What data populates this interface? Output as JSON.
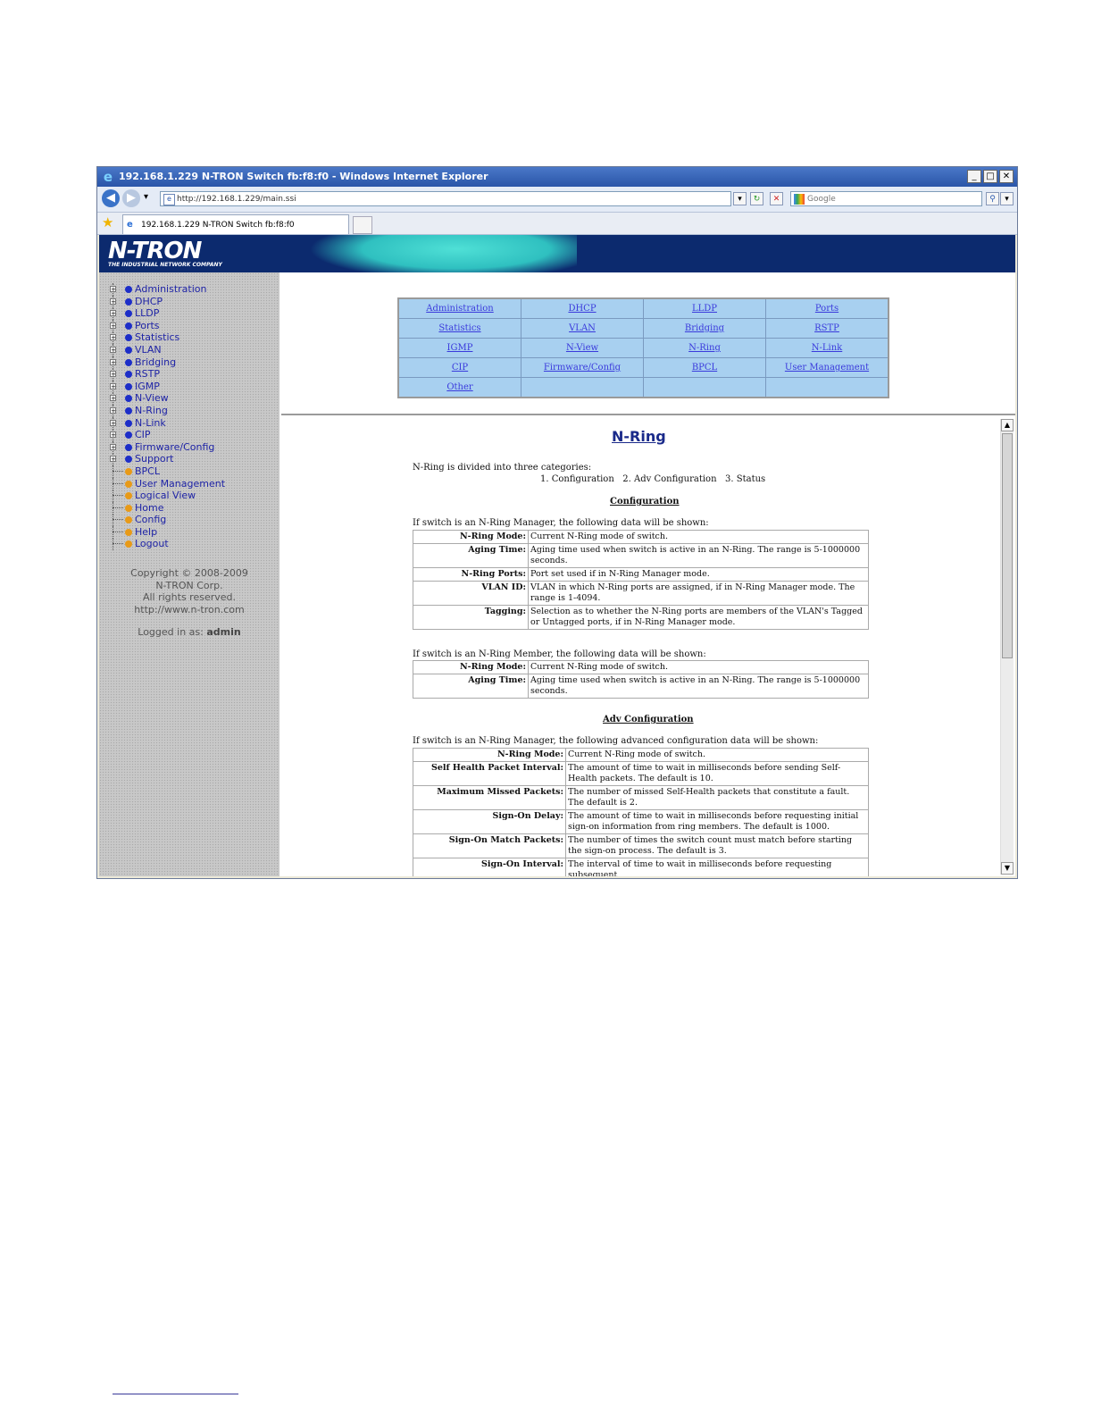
{
  "window": {
    "title": "192.168.1.229 N-TRON Switch fb:f8:f0 - Windows Internet Explorer",
    "minimize": "_",
    "maximize": "□",
    "close": "✕"
  },
  "navbar": {
    "back": "◀",
    "forward": "▶",
    "dropdown": "▾",
    "address": "http://192.168.1.229/main.ssi",
    "search_placeholder": "Google",
    "search_icon": "search-icon"
  },
  "tab": {
    "label": "192.168.1.229 N-TRON Switch fb:f8:f0"
  },
  "banner": {
    "logo": "N-TRON",
    "tagline": "THE INDUSTRIAL NETWORK COMPANY"
  },
  "sidebar": {
    "items": [
      {
        "label": "Administration",
        "type": "folder"
      },
      {
        "label": "DHCP",
        "type": "folder"
      },
      {
        "label": "LLDP",
        "type": "folder"
      },
      {
        "label": "Ports",
        "type": "folder"
      },
      {
        "label": "Statistics",
        "type": "folder"
      },
      {
        "label": "VLAN",
        "type": "folder"
      },
      {
        "label": "Bridging",
        "type": "folder"
      },
      {
        "label": "RSTP",
        "type": "folder"
      },
      {
        "label": "IGMP",
        "type": "folder"
      },
      {
        "label": "N-View",
        "type": "folder"
      },
      {
        "label": "N-Ring",
        "type": "folder"
      },
      {
        "label": "N-Link",
        "type": "folder"
      },
      {
        "label": "CIP",
        "type": "folder"
      },
      {
        "label": "Firmware/Config",
        "type": "folder"
      },
      {
        "label": "Support",
        "type": "folder"
      },
      {
        "label": "BPCL",
        "type": "page"
      },
      {
        "label": "User Management",
        "type": "page"
      },
      {
        "label": "Logical View",
        "type": "page"
      },
      {
        "label": "Home",
        "type": "page"
      },
      {
        "label": "Config",
        "type": "page"
      },
      {
        "label": "Help",
        "type": "page"
      },
      {
        "label": "Logout",
        "type": "page"
      }
    ],
    "copyright_lines": [
      "Copyright © 2008-2009",
      "N-TRON Corp.",
      "All rights reserved.",
      "http://www.n-tron.com"
    ],
    "logged_prefix": "Logged in as:",
    "logged_user": "admin"
  },
  "menu_grid": [
    [
      "Administration",
      "DHCP",
      "LLDP",
      "Ports"
    ],
    [
      "Statistics",
      "VLAN",
      "Bridging",
      "RSTP"
    ],
    [
      "IGMP",
      "N-View",
      "N-Ring",
      "N-Link"
    ],
    [
      "CIP",
      "Firmware/Config",
      "BPCL",
      "User Management"
    ],
    [
      "Other",
      "",
      "",
      ""
    ]
  ],
  "help": {
    "title": "N-Ring",
    "intro": "N-Ring is divided into three categories:",
    "categories": "1. Configuration   2. Adv Configuration   3. Status",
    "section1": "Configuration",
    "manager_intro": "If switch is an N-Ring Manager, the following data will be shown:",
    "manager_rows": [
      {
        "k": "N-Ring Mode:",
        "v": "Current N-Ring mode of switch."
      },
      {
        "k": "Aging Time:",
        "v": "Aging time used when switch is active in an N-Ring. The range is 5-1000000 seconds."
      },
      {
        "k": "N-Ring Ports:",
        "v": "Port set used if in N-Ring Manager mode."
      },
      {
        "k": "VLAN ID:",
        "v": "VLAN in which N-Ring ports are assigned, if in N-Ring Manager mode. The range is 1-4094."
      },
      {
        "k": "Tagging:",
        "v": "Selection as to whether the N-Ring ports are members of the VLAN's Tagged or Untagged ports, if in N-Ring Manager mode."
      }
    ],
    "member_intro": "If switch is an N-Ring Member, the following data will be shown:",
    "member_rows": [
      {
        "k": "N-Ring Mode:",
        "v": "Current N-Ring mode of switch."
      },
      {
        "k": "Aging Time:",
        "v": "Aging time used when switch is active in an N-Ring. The range is 5-1000000 seconds."
      }
    ],
    "section2": "Adv Configuration",
    "adv_intro": "If switch is an N-Ring Manager, the following advanced configuration data will be shown:",
    "adv_rows": [
      {
        "k": "N-Ring Mode:",
        "v": "Current N-Ring mode of switch."
      },
      {
        "k": "Self Health Packet Interval:",
        "v": "The amount of time to wait in milliseconds before sending Self-Health packets. The default is 10."
      },
      {
        "k": "Maximum Missed Packets:",
        "v": "The number of missed Self-Health packets that constitute a fault. The default is 2."
      },
      {
        "k": "Sign-On Delay:",
        "v": "The amount of time to wait in milliseconds before requesting initial sign-on information from ring members. The default is 1000."
      },
      {
        "k": "Sign-On Match Packets:",
        "v": "The number of times the switch count must match before starting the sign-on process. The default is 3."
      },
      {
        "k": "Sign-On Interval:",
        "v": "The interval of time to wait in milliseconds before requesting subsequent"
      }
    ]
  }
}
